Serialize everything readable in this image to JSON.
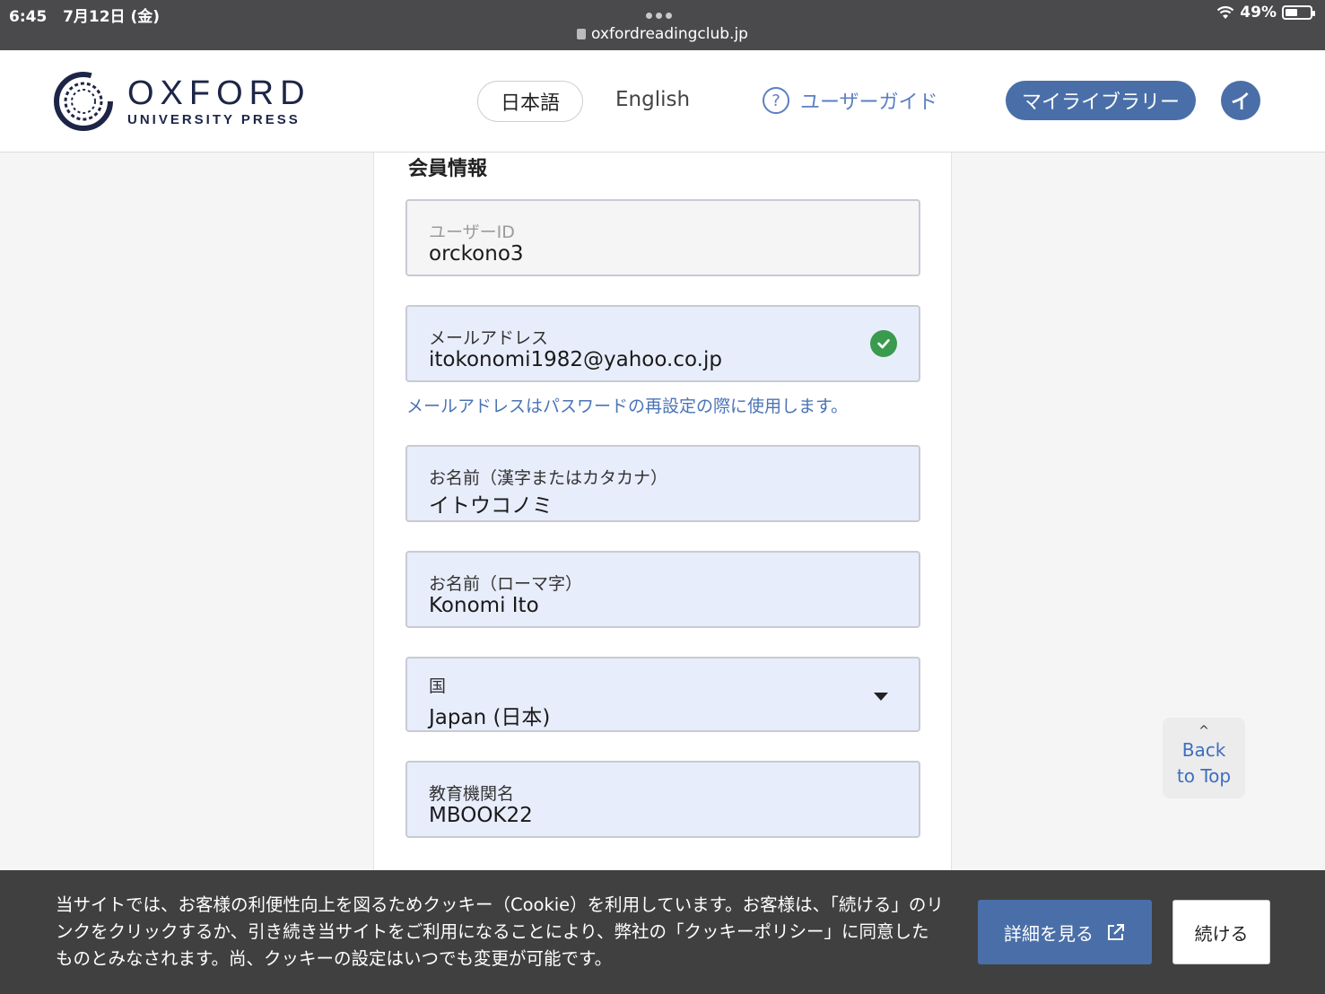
{
  "status_bar": {
    "time": "6:45",
    "date": "7月12日 (金)",
    "url": "oxfordreadingclub.jp",
    "battery": "49%",
    "battery_level": 0.49
  },
  "header": {
    "logo_main": "OXFORD",
    "logo_sub": "UNIVERSITY PRESS",
    "lang_ja": "日本語",
    "lang_en": "English",
    "guide_label": "ユーザーガイド",
    "guide_icon": "question-circle-icon",
    "library_label": "マイライブラリー",
    "avatar_initial": "イ"
  },
  "form": {
    "section_title": "会員情報",
    "fields": [
      {
        "label": "ユーザーID",
        "value": "orckono3"
      },
      {
        "label": "メールアドレス",
        "value": "itokonomi1982@yahoo.co.jp",
        "status_icon": "check-circle-icon"
      },
      {
        "label": "お名前（漢字またはカタカナ）",
        "value": "イトウコノミ"
      },
      {
        "label": "お名前（ローマ字）",
        "value": "Konomi Ito"
      },
      {
        "label": "国",
        "value": "Japan (日本)",
        "icon": "caret-down-icon"
      },
      {
        "label": "教育機関名",
        "value": "MBOOK22"
      }
    ],
    "email_hint": "メールアドレスはパスワードの再設定の際に使用します。"
  },
  "back_to_top": {
    "line1": "Back",
    "line2": "to Top"
  },
  "cookie": {
    "text": "当サイトでは、お客様の利便性向上を図るためクッキー（Cookie）を利用しています。お客様は、「続ける」のリンクをクリックするか、引き続き当サイトをご利用になることにより、弊社の「クッキーポリシー」に同意したものとみなされます。尚、クッキーの設定はいつでも変更が可能です。",
    "details_label": "詳細を見る",
    "continue_label": "続ける"
  },
  "colors": {
    "brand_blue": "#4a6fa8",
    "navy": "#1d2547",
    "success_green": "#3a9a4e",
    "field_fill": "#e8edfb"
  }
}
